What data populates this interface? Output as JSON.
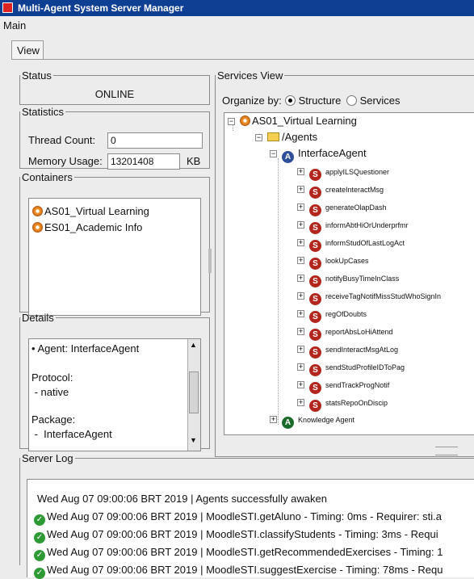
{
  "window": {
    "title": "Multi-Agent System Server Manager"
  },
  "menu": {
    "main": "Main"
  },
  "tabs": [
    {
      "label": "View"
    }
  ],
  "status": {
    "legend": "Status",
    "value": "ONLINE"
  },
  "statistics": {
    "legend": "Statistics",
    "thread_count_label": "Thread Count:",
    "thread_count_value": "0",
    "memory_usage_label": "Memory Usage:",
    "memory_usage_value": "13201408",
    "memory_unit": "KB"
  },
  "containers": {
    "legend": "Containers",
    "items": [
      "AS01_Virtual Learning",
      "ES01_Academic Info"
    ]
  },
  "details": {
    "legend": "Details",
    "lines": [
      "• Agent: InterfaceAgent",
      "Protocol:",
      " - native",
      "Package:",
      " -  InterfaceAgent"
    ]
  },
  "services_view": {
    "legend": "Services View",
    "organize_label": "Organize by:",
    "option_structure": "Structure",
    "option_services": "Services",
    "root": "AS01_Virtual Learning",
    "agents_folder": "/Agents",
    "interface_agent": "InterfaceAgent",
    "services": [
      "applyILSQuestioner",
      "createInteractMsg",
      "generateOlapDash",
      "informAbtHiOrUnderprfmr",
      "informStudOfLastLogAct",
      "lookUpCases",
      "notifyBusyTimeInClass",
      "receiveTagNotifMissStudWhoSignIn",
      "regOfDoubts",
      "reportAbsLoHiAttend",
      "sendInteractMsgAtLog",
      "sendStudProfileIDToPag",
      "sendTrackProgNotif",
      "statsRepoOnDiscip"
    ],
    "knowledge_agent": "Knowledge Agent",
    "badge_agent": "A",
    "badge_service": "S"
  },
  "server_log": {
    "legend": "Server Log",
    "entries": [
      "Wed Aug 07 09:00:06 BRT 2019 | Agents successfully awaken",
      "Wed Aug 07 09:00:06 BRT 2019 |  MoodleSTI.getAluno - Timing: 0ms - Requirer: sti.a",
      "Wed Aug 07 09:00:06 BRT 2019 |  MoodleSTI.classifyStudents - Timing: 3ms - Requi",
      "Wed Aug 07 09:00:06 BRT 2019 |  MoodleSTI.getRecommendedExercises - Timing: 1",
      "Wed Aug 07 09:00:06 BRT 2019 |  MoodleSTI.suggestExercise - Timing: 78ms - Requ"
    ]
  },
  "colors": {
    "titlebar": "#0f3f93",
    "service_badge": "#b2261e",
    "agent_badge": "#2f4f9a",
    "ok_check": "#2e9a35"
  }
}
